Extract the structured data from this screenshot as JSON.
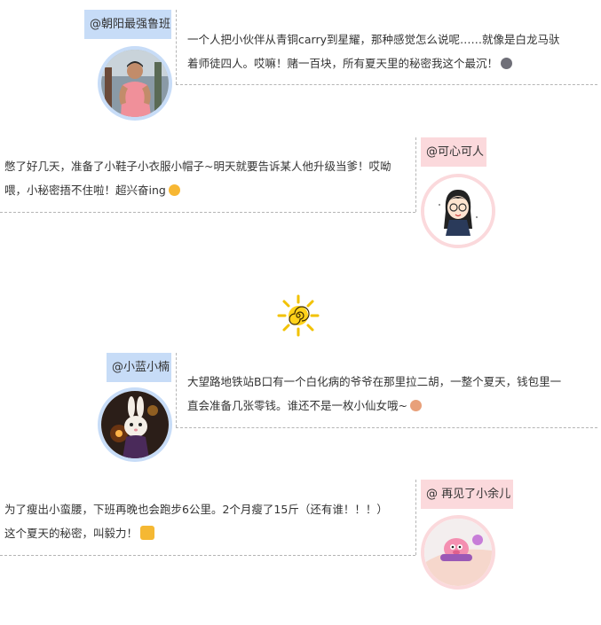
{
  "posts": [
    {
      "author": "@朝阳最强鲁班",
      "lines": [
        "一个人把小伙伴从青铜carry到星耀，那种感觉怎么说呢……就像是白龙马驮",
        "着师徒四人。哎嘛！赌一百块，所有夏天里的秘密我这个最沉！"
      ],
      "emoji": "smirk-emoji",
      "accent": "#c7dcf7"
    },
    {
      "author": "@可心可人",
      "lines": [
        "憋了好几天，准备了小鞋子小衣服小帽子~明天就要告诉某人他升级当爹！哎呦",
        "喂，小秘密捂不住啦！超兴奋ing"
      ],
      "emoji": "excited-emoji",
      "accent": "#fbd9dc"
    },
    {
      "author": "@小蓝小楠",
      "lines": [
        "大望路地铁站B口有一个白化病的爷爷在那里拉二胡，一整个夏天，钱包里一",
        "直会准备几张零钱。谁还不是一枚小仙女哦~"
      ],
      "emoji": "girl-emoji",
      "accent": "#c7dcf7"
    },
    {
      "author": "@ 再见了小余儿",
      "lines": [
        "为了瘦出小蛮腰，下班再晚也会跑步6公里。2个月瘦了15斤（还有谁！！！）",
        "这个夏天的秘密，叫毅力！"
      ],
      "emoji": "flexed-biceps-emoji",
      "accent": "#fbd9dc"
    }
  ],
  "decoration": "sun-icon"
}
